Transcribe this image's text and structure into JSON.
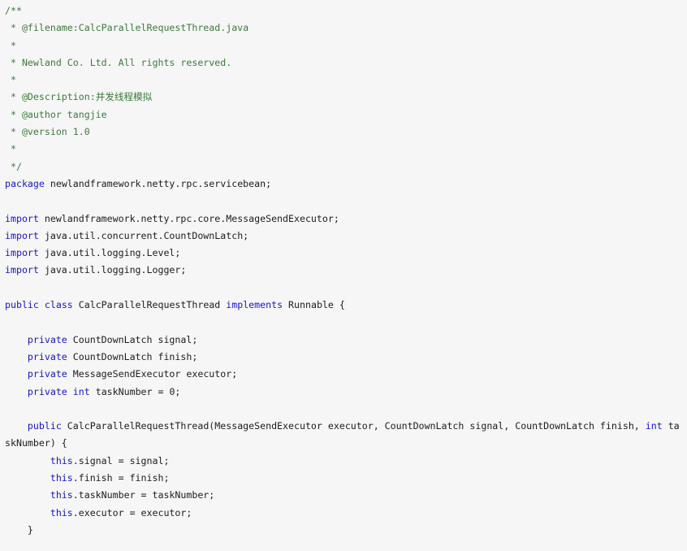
{
  "editor": {
    "name": "java-source-code-view",
    "language": "Java",
    "background_color": "#f6f6f6",
    "colors": {
      "keyword": "#1616c8",
      "comment": "#3b7a3b",
      "plain": "#1c1c1c"
    }
  },
  "code": {
    "lines": [
      {
        "indent": 0,
        "tokens": [
          {
            "t": "comment",
            "s": "/**"
          }
        ]
      },
      {
        "indent": 0,
        "tokens": [
          {
            "t": "comment",
            "s": " * @filename:CalcParallelRequestThread.java"
          }
        ]
      },
      {
        "indent": 0,
        "tokens": [
          {
            "t": "comment",
            "s": " *"
          }
        ]
      },
      {
        "indent": 0,
        "tokens": [
          {
            "t": "comment",
            "s": " * Newland Co. Ltd. All rights reserved."
          }
        ]
      },
      {
        "indent": 0,
        "tokens": [
          {
            "t": "comment",
            "s": " *"
          }
        ]
      },
      {
        "indent": 0,
        "tokens": [
          {
            "t": "comment",
            "s": " * @Description:"
          },
          {
            "t": "comment-cjk",
            "s": "并发线程模拟"
          }
        ]
      },
      {
        "indent": 0,
        "tokens": [
          {
            "t": "comment",
            "s": " * @author tangjie"
          }
        ]
      },
      {
        "indent": 0,
        "tokens": [
          {
            "t": "comment",
            "s": " * @version 1.0"
          }
        ]
      },
      {
        "indent": 0,
        "tokens": [
          {
            "t": "comment",
            "s": " *"
          }
        ]
      },
      {
        "indent": 0,
        "tokens": [
          {
            "t": "comment",
            "s": " */"
          }
        ]
      },
      {
        "indent": 0,
        "tokens": [
          {
            "t": "kw",
            "s": "package"
          },
          {
            "t": "plain",
            "s": " newlandframework.netty.rpc.servicebean;"
          }
        ]
      },
      {
        "indent": 0,
        "tokens": []
      },
      {
        "indent": 0,
        "tokens": [
          {
            "t": "kw",
            "s": "import"
          },
          {
            "t": "plain",
            "s": " newlandframework.netty.rpc.core.MessageSendExecutor;"
          }
        ]
      },
      {
        "indent": 0,
        "tokens": [
          {
            "t": "kw",
            "s": "import"
          },
          {
            "t": "plain",
            "s": " java.util.concurrent.CountDownLatch;"
          }
        ]
      },
      {
        "indent": 0,
        "tokens": [
          {
            "t": "kw",
            "s": "import"
          },
          {
            "t": "plain",
            "s": " java.util.logging.Level;"
          }
        ]
      },
      {
        "indent": 0,
        "tokens": [
          {
            "t": "kw",
            "s": "import"
          },
          {
            "t": "plain",
            "s": " java.util.logging.Logger;"
          }
        ]
      },
      {
        "indent": 0,
        "tokens": []
      },
      {
        "indent": 0,
        "tokens": [
          {
            "t": "kw",
            "s": "public"
          },
          {
            "t": "plain",
            "s": " "
          },
          {
            "t": "kw",
            "s": "class"
          },
          {
            "t": "plain",
            "s": " CalcParallelRequestThread "
          },
          {
            "t": "kw",
            "s": "implements"
          },
          {
            "t": "plain",
            "s": " Runnable {"
          }
        ]
      },
      {
        "indent": 0,
        "tokens": []
      },
      {
        "indent": 0,
        "tokens": [
          {
            "t": "plain",
            "s": "    "
          },
          {
            "t": "kw",
            "s": "private"
          },
          {
            "t": "plain",
            "s": " CountDownLatch signal;"
          }
        ]
      },
      {
        "indent": 0,
        "tokens": [
          {
            "t": "plain",
            "s": "    "
          },
          {
            "t": "kw",
            "s": "private"
          },
          {
            "t": "plain",
            "s": " CountDownLatch finish;"
          }
        ]
      },
      {
        "indent": 0,
        "tokens": [
          {
            "t": "plain",
            "s": "    "
          },
          {
            "t": "kw",
            "s": "private"
          },
          {
            "t": "plain",
            "s": " MessageSendExecutor executor;"
          }
        ]
      },
      {
        "indent": 0,
        "tokens": [
          {
            "t": "plain",
            "s": "    "
          },
          {
            "t": "kw",
            "s": "private"
          },
          {
            "t": "plain",
            "s": " "
          },
          {
            "t": "kw",
            "s": "int"
          },
          {
            "t": "plain",
            "s": " taskNumber = 0;"
          }
        ]
      },
      {
        "indent": 0,
        "tokens": []
      },
      {
        "indent": 0,
        "tokens": [
          {
            "t": "plain",
            "s": "    "
          },
          {
            "t": "kw",
            "s": "public"
          },
          {
            "t": "plain",
            "s": " CalcParallelRequestThread(MessageSendExecutor executor, CountDownLatch signal, CountDownLatch finish, "
          },
          {
            "t": "kw",
            "s": "int"
          },
          {
            "t": "plain",
            "s": " ta"
          }
        ]
      },
      {
        "indent": 0,
        "tokens": [
          {
            "t": "plain",
            "s": "skNumber) {"
          }
        ]
      },
      {
        "indent": 0,
        "tokens": [
          {
            "t": "plain",
            "s": "        "
          },
          {
            "t": "kw",
            "s": "this"
          },
          {
            "t": "plain",
            "s": ".signal = signal;"
          }
        ]
      },
      {
        "indent": 0,
        "tokens": [
          {
            "t": "plain",
            "s": "        "
          },
          {
            "t": "kw",
            "s": "this"
          },
          {
            "t": "plain",
            "s": ".finish = finish;"
          }
        ]
      },
      {
        "indent": 0,
        "tokens": [
          {
            "t": "plain",
            "s": "        "
          },
          {
            "t": "kw",
            "s": "this"
          },
          {
            "t": "plain",
            "s": ".taskNumber = taskNumber;"
          }
        ]
      },
      {
        "indent": 0,
        "tokens": [
          {
            "t": "plain",
            "s": "        "
          },
          {
            "t": "kw",
            "s": "this"
          },
          {
            "t": "plain",
            "s": ".executor = executor;"
          }
        ]
      },
      {
        "indent": 0,
        "tokens": [
          {
            "t": "plain",
            "s": "    }"
          }
        ]
      }
    ]
  }
}
